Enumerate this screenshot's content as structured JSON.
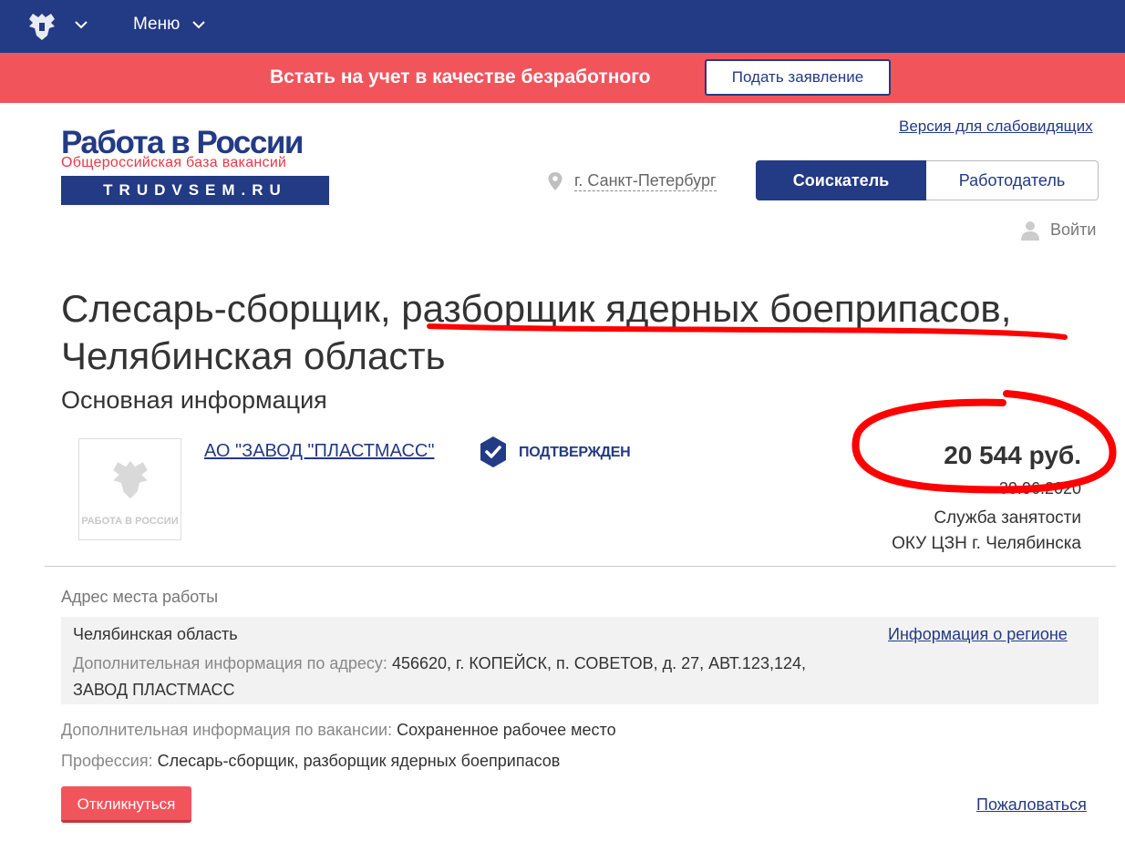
{
  "topbar": {
    "menu_label": "Меню",
    "background": "#233a84"
  },
  "banner": {
    "text": "Встать на учет в качестве безработного",
    "button_label": "Подать заявление",
    "background": "#f2545c"
  },
  "header": {
    "logo_title": "Работа в России",
    "logo_subtitle": "Общероссийская база вакансий",
    "logo_domain": "TRUDVSEM.RU",
    "accessibility_link": "Версия для слабовидящих",
    "city": "г. Санкт-Петербург",
    "tabs": [
      {
        "label": "Соискатель",
        "active": true
      },
      {
        "label": "Работодатель",
        "active": false
      }
    ],
    "login_label": "Войти"
  },
  "vacancy": {
    "title": "Слесарь-сборщик, разборщик ядерных боеприпасов, Челябинская область",
    "section_heading": "Основная информация",
    "company": {
      "name": "АО \"ЗАВОД \"ПЛАСТМАСС\"",
      "verified_label": "ПОДТВЕРЖДЕН",
      "logo_watermark": "РАБОТА В РОССИИ"
    },
    "salary": "20 544 руб.",
    "date_partial": "30.06.2020",
    "service_line1": "Служба занятости",
    "service_line2": "ОКУ ЦЗН г. Челябинска"
  },
  "address": {
    "label": "Адрес места работы",
    "region": "Челябинская область",
    "extra_label": "Дополнительная информация по адресу:",
    "extra_value": "456620, г. КОПЕЙСК, п. СОВЕТОВ, д. 27, АВТ.123,124, ЗАВОД ПЛАСТМАСС",
    "region_link": "Информация о регионе"
  },
  "details": {
    "vacancy_info_label": "Дополнительная информация по вакансии:",
    "vacancy_info_value": "Сохраненное рабочее место",
    "profession_label": "Профессия:",
    "profession_value": "Слесарь-сборщик, разборщик ядерных боеприпасов"
  },
  "actions": {
    "respond_label": "Откликнуться",
    "complain_label": "Пожаловаться"
  },
  "annotations": {
    "color": "#ff0000"
  }
}
